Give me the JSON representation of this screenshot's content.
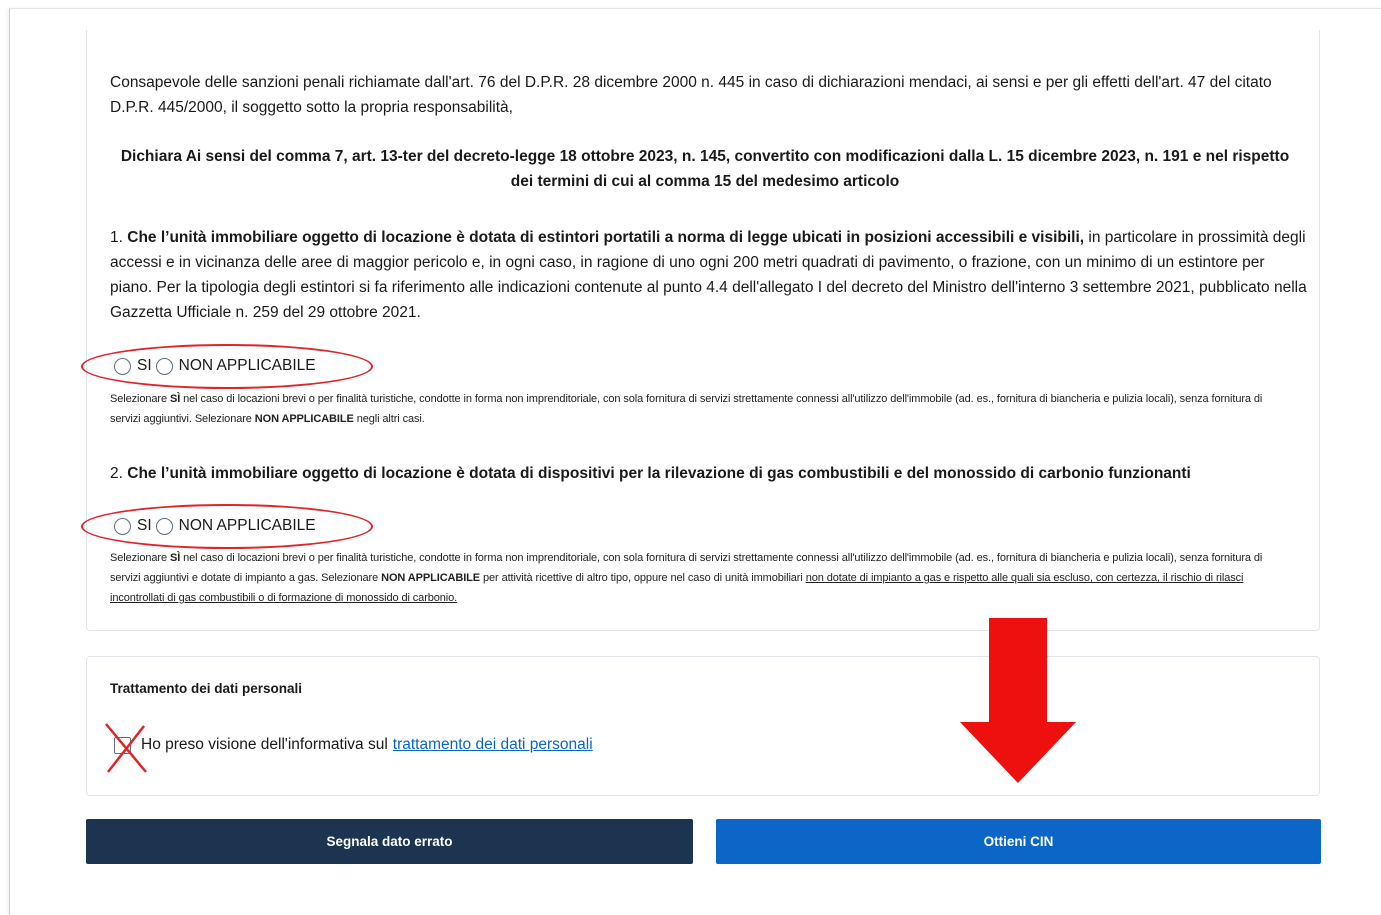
{
  "intro": "Consapevole delle sanzioni penali richiamate dall'art. 76 del D.P.R. 28 dicembre 2000 n. 445 in caso di dichiarazioni mendaci, ai sensi e per gli effetti dell'art. 47 del citato D.P.R. 445/2000, il soggetto sotto la propria responsabilità,",
  "declaration": "Dichiara Ai sensi del comma 7, art. 13-ter del decreto-legge 18 ottobre 2023, n. 145, convertito con modificazioni dalla L. 15 dicembre 2023, n. 191 e nel rispetto dei termini di cui al comma 15 del medesimo articolo",
  "item1": {
    "number": "1.",
    "bold": "Che l’unità immobiliare oggetto di locazione è dotata di estintori portatili a norma di legge ubicati in posizioni accessibili e visibili,",
    "text": "in particolare in prossimità degli accessi e in vicinanza delle aree di maggior pericolo e, in ogni caso, in ragione di uno ogni 200 metri quadrati di pavimento, o frazione, con un minimo di un estintore per piano. Per la tipologia degli estintori si fa riferimento alle indicazioni contenute al punto 4.4 dell'allegato I del decreto del Ministro dell'interno 3 settembre 2021, pubblicato nella Gazzetta Ufficiale n. 259 del 29 ottobre 2021.",
    "option_si": "SI",
    "option_na": "NON APPLICABILE",
    "help_a": "Selezionare",
    "help_si": "SÌ",
    "help_b": "nel caso di locazioni brevi o per finalità turistiche, condotte in forma non imprenditoriale, con sola fornitura di servizi strettamente connessi all'utilizzo dell'immobile (ad. es., fornitura di biancheria e pulizia locali), senza fornitura di servizi aggiuntivi. Selezionare",
    "help_na": "NON APPLICABILE",
    "help_c": "negli altri casi."
  },
  "item2": {
    "number": "2.",
    "bold": "Che l’unità immobiliare oggetto di locazione è dotata di dispositivi per la rilevazione di gas combustibili e del monossido di carbonio funzionanti",
    "option_si": "SI",
    "option_na": "NON APPLICABILE",
    "help_a": "Selezionare",
    "help_si": "SÌ",
    "help_b": "nel caso di locazioni brevi o per finalità turistiche, condotte in forma non imprenditoriale, con sola fornitura di servizi strettamente connessi all'utilizzo dell'immobile (ad. es., fornitura di biancheria e pulizia locali), senza fornitura di servizi aggiuntivi e dotate di impianto a gas. Selezionare",
    "help_na": "NON APPLICABILE",
    "help_c": "per attività ricettive di altro tipo, oppure nel caso di unità immobiliari",
    "help_underlined": "non dotate di impianto a gas e rispetto alle quali sia escluso, con certezza, il rischio di rilasci incontrollati di gas combustibili o di formazione di monossido di carbonio."
  },
  "privacy": {
    "title": "Trattamento dei dati personali",
    "consent_text": "Ho preso visione dell'informativa sul",
    "consent_link": "trattamento dei dati personali"
  },
  "buttons": {
    "report": "Segnala dato errato",
    "obtain": "Ottieni CIN"
  },
  "colors": {
    "annotation_red": "#e0242a",
    "button_dark": "#1c3450",
    "button_blue": "#0b66c8",
    "link_blue": "#0a66c2"
  }
}
